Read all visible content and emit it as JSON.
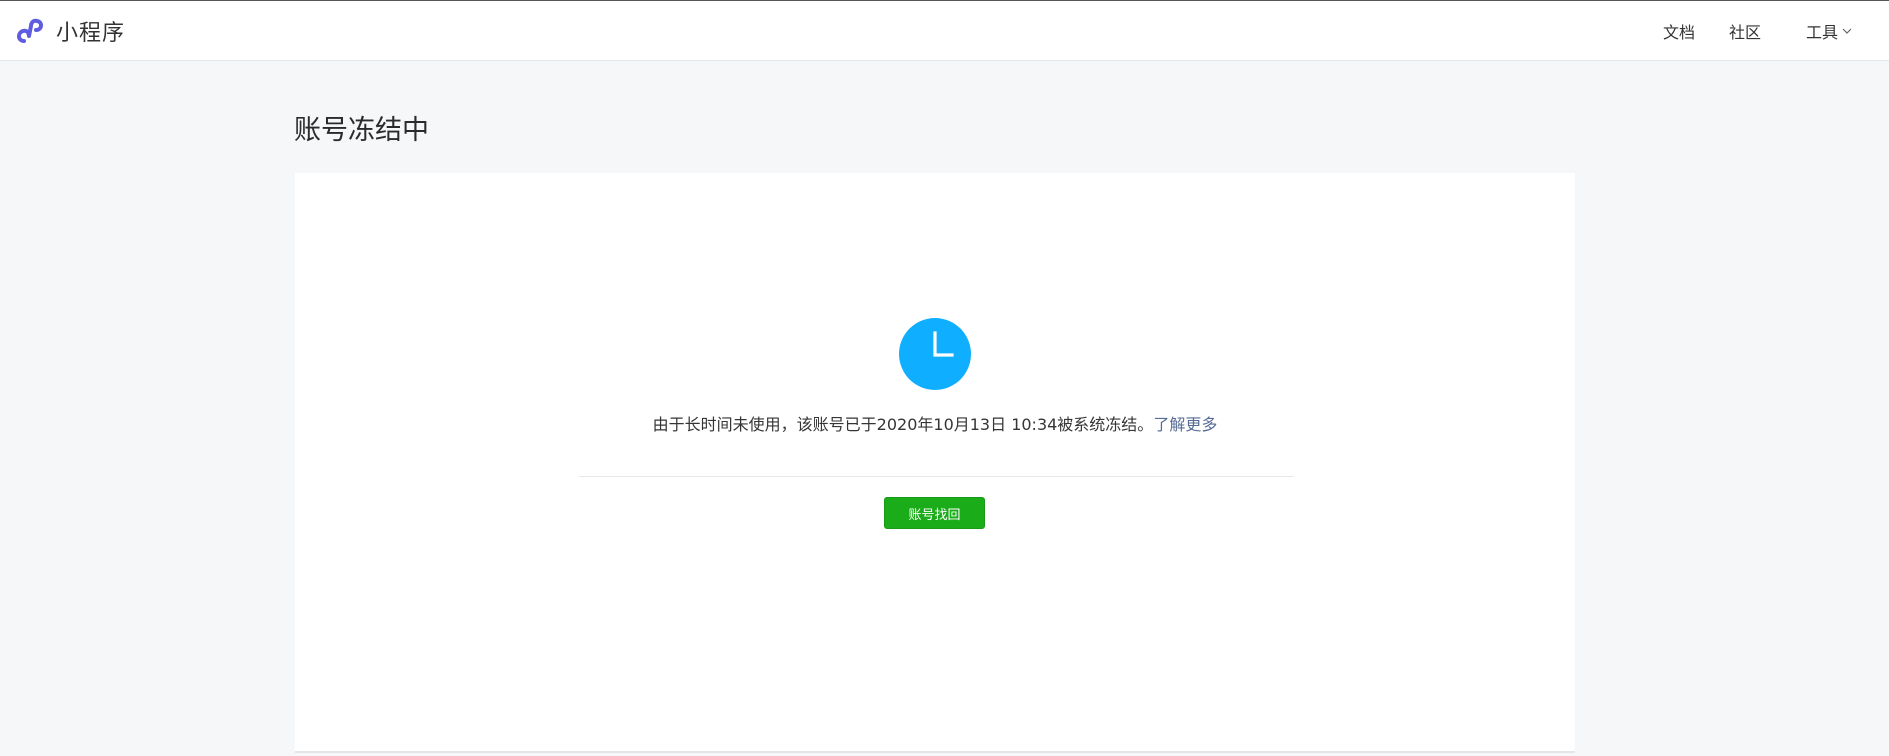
{
  "header": {
    "brand_title": "小程序",
    "logo_icon": "miniprogram-logo-icon",
    "nav": {
      "docs": "文档",
      "community": "社区",
      "tools": "工具"
    }
  },
  "page": {
    "title": "账号冻结中"
  },
  "status": {
    "icon": "clock-icon",
    "icon_color": "#10aeff",
    "message": "由于长时间未使用，该账号已于2020年10月13日 10:34被系统冻结。",
    "learn_more": "了解更多"
  },
  "actions": {
    "recover_label": "账号找回",
    "button_color": "#1aad19"
  },
  "colors": {
    "link": "#576b95",
    "background": "#f6f7f9"
  }
}
